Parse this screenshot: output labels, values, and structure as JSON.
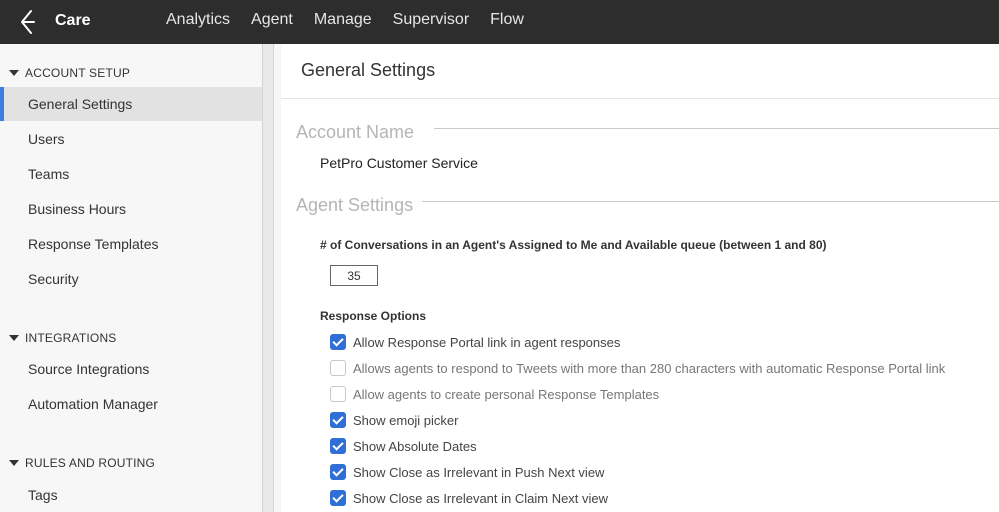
{
  "app": {
    "brand": "Care"
  },
  "nav": [
    "Analytics",
    "Agent",
    "Manage",
    "Supervisor",
    "Flow"
  ],
  "sidebar": {
    "sections": [
      {
        "title": "ACCOUNT SETUP",
        "items": [
          "General Settings",
          "Users",
          "Teams",
          "Business Hours",
          "Response Templates",
          "Security"
        ]
      },
      {
        "title": "INTEGRATIONS",
        "items": [
          "Source Integrations",
          "Automation Manager"
        ]
      },
      {
        "title": "RULES AND ROUTING",
        "items": [
          "Tags"
        ]
      }
    ],
    "active": "General Settings"
  },
  "page": {
    "title": "General Settings",
    "account_legend": "Account Name",
    "account_value": "PetPro Customer Service",
    "agent_legend": "Agent Settings",
    "queue_label": "# of Conversations in an Agent's Assigned to Me and Available queue (between 1 and 80)",
    "queue_value": "35",
    "response_label": "Response Options",
    "options": [
      {
        "label": "Allow Response Portal link in agent responses",
        "checked": true
      },
      {
        "label": "Allows agents to respond to Tweets with more than 280 characters with automatic Response Portal link",
        "checked": false
      },
      {
        "label": "Allow agents to create personal Response Templates",
        "checked": false
      },
      {
        "label": "Show emoji picker",
        "checked": true
      },
      {
        "label": "Show Absolute Dates",
        "checked": true
      },
      {
        "label": "Show Close as Irrelevant in Push Next view",
        "checked": true
      },
      {
        "label": "Show Close as Irrelevant in Claim Next view",
        "checked": true
      }
    ]
  },
  "colors": {
    "topbar": "#2d2d2d",
    "accent": "#2f6fd6",
    "active_bar": "#3f7ce0"
  },
  "icons": {
    "logo": "care-logo-icon",
    "section_toggle": "triangle-down-icon",
    "checkbox": "checkbox-icon"
  }
}
